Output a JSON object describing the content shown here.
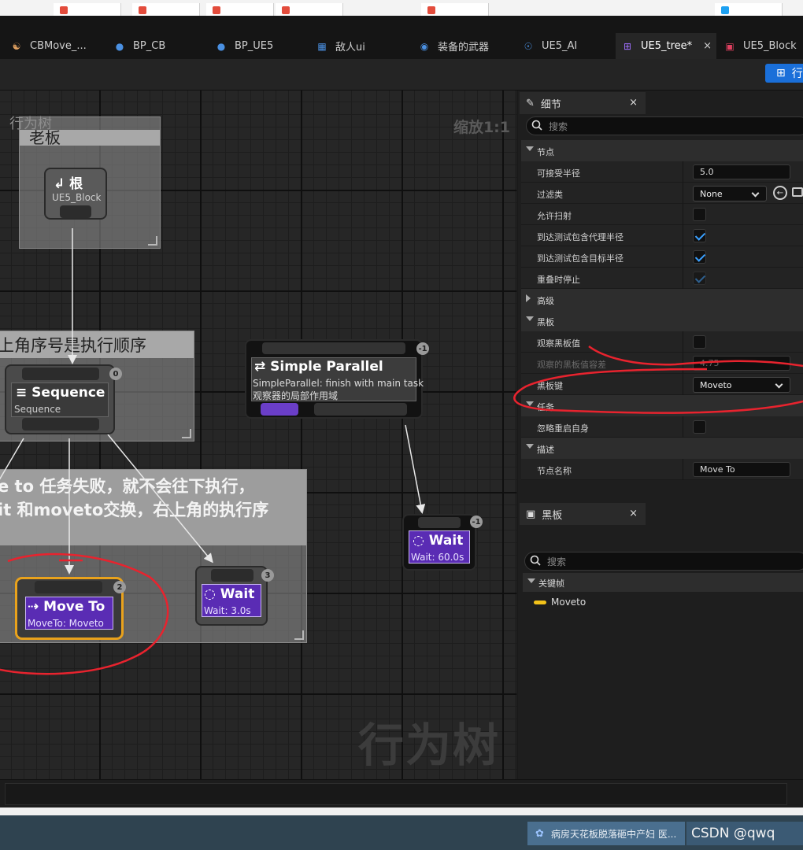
{
  "editor_tabs": [
    {
      "label": "CBMove_...",
      "icon": "character-icon"
    },
    {
      "label": "BP_CB",
      "icon": "pawn-icon"
    },
    {
      "label": "BP_UE5",
      "icon": "pawn-icon"
    },
    {
      "label": "敌人ui",
      "icon": "widget-icon"
    },
    {
      "label": "装备的武器",
      "icon": "blueprint-icon"
    },
    {
      "label": "UE5_AI",
      "icon": "ai-controller-icon"
    },
    {
      "label": "UE5_tree*",
      "icon": "behavior-tree-icon"
    },
    {
      "label": "UE5_Block",
      "icon": "blackboard-icon"
    }
  ],
  "toolbar": {
    "button_label": "行"
  },
  "graph": {
    "title": "行为树",
    "zoom": "缩放1:1",
    "watermark": "行为树",
    "comments": {
      "blackboard_comment": "老板",
      "order_comment": "上角序号是执行顺序",
      "fail_comment_line1": "e to 任务失败，就不会往下执行，",
      "fail_comment_line2": "it 和moveto交换，右上角的执行序"
    },
    "nodes": {
      "root": {
        "title": "根",
        "subtitle": "UE5_Block"
      },
      "sequence": {
        "title": "Sequence",
        "subtitle": "Sequence",
        "badge": "0"
      },
      "parallel": {
        "title": "Simple Parallel",
        "subtitle1": "SimpleParallel: finish with main task",
        "subtitle2": "观察器的局部作用域",
        "badge": "-1"
      },
      "wait_right": {
        "title": "Wait",
        "subtitle": "Wait: 60.0s",
        "badge": "-1"
      },
      "move_to": {
        "title": "Move To",
        "subtitle": "MoveTo: Moveto",
        "badge": "2"
      },
      "wait_mid": {
        "title": "Wait",
        "subtitle": "Wait: 3.0s",
        "badge": "3"
      }
    }
  },
  "details": {
    "tab_label": "细节",
    "search_placeholder": "搜索",
    "sections": {
      "node": "节点",
      "advanced": "高级",
      "blackboard": "黑板",
      "task": "任务",
      "description": "描述"
    },
    "rows": {
      "acceptable_radius": {
        "label": "可接受半径",
        "value": "5.0"
      },
      "filter_class": {
        "label": "过滤类",
        "value": "None"
      },
      "allow_strafe": {
        "label": "允许扫射"
      },
      "reach_agent_radius": {
        "label": "到达测试包含代理半径"
      },
      "reach_goal_radius": {
        "label": "到达测试包含目标半径"
      },
      "stop_on_overlap": {
        "label": "重叠时停止"
      },
      "observe_bb": {
        "label": "观察黑板值"
      },
      "observe_tolerance": {
        "label": "观察的黑板值容差",
        "value": "4.75"
      },
      "bb_key": {
        "label": "黑板键",
        "value": "Moveto"
      },
      "ignore_restart": {
        "label": "忽略重启自身"
      },
      "node_name": {
        "label": "节点名称",
        "value": "Move To"
      }
    }
  },
  "blackboard_panel": {
    "tab_label": "黑板",
    "search_placeholder": "搜索",
    "category": "关键帧",
    "key": "Moveto"
  },
  "taskbar": {
    "notice": "病房天花板脱落砸中产妇 医...",
    "csdn": "CSDN @qwq"
  },
  "colors": {
    "accent": "#1a6fd9",
    "task": "#5a2cb4",
    "annotation": "#e8232e",
    "selected": "#e9a21c"
  }
}
